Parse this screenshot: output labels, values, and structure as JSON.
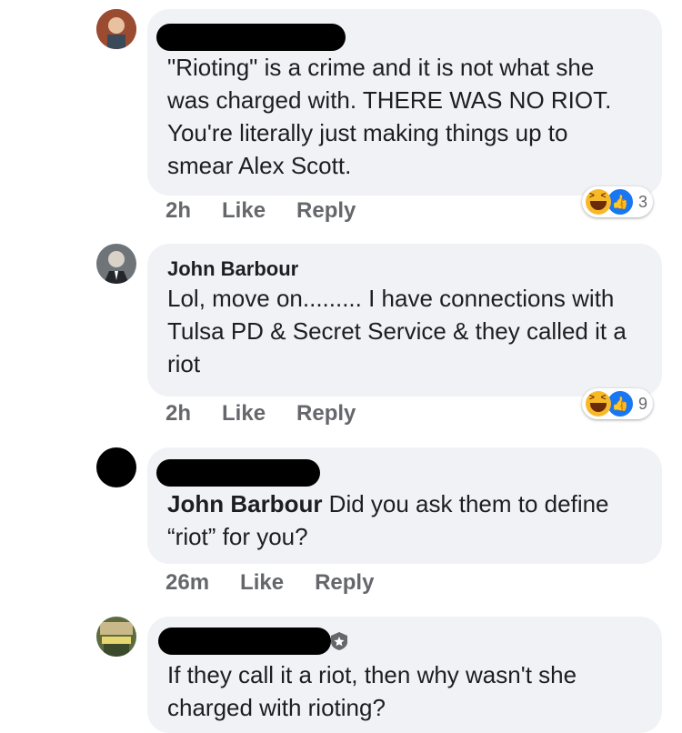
{
  "comments": [
    {
      "author": "",
      "text": "\"Rioting\" is a crime and it is not what she was charged with. THERE WAS NO RIOT. You're literally just making things up to smear Alex Scott.",
      "time": "2h",
      "like_label": "Like",
      "reply_label": "Reply",
      "reaction_count": "3"
    },
    {
      "author": "John Barbour",
      "text": "Lol, move on......... I have connections with Tulsa PD & Secret Service & they called it a riot",
      "time": "2h",
      "like_label": "Like",
      "reply_label": "Reply",
      "reaction_count": "9"
    },
    {
      "author": "",
      "mention": "John Barbour",
      "text": " Did you ask them to define “riot” for you?",
      "time": "26m",
      "like_label": "Like",
      "reply_label": "Reply"
    },
    {
      "author": "",
      "text": "If they call it a riot, then why wasn't she charged with rioting?"
    }
  ],
  "colors": {
    "bubble": "#f0f2f5",
    "action_text": "#65676b",
    "like_blue": "#1877f2",
    "haha_yellow": "#f7b928"
  },
  "icons": [
    "avatar",
    "haha-reaction-icon",
    "like-reaction-icon",
    "moderator-badge-icon"
  ]
}
